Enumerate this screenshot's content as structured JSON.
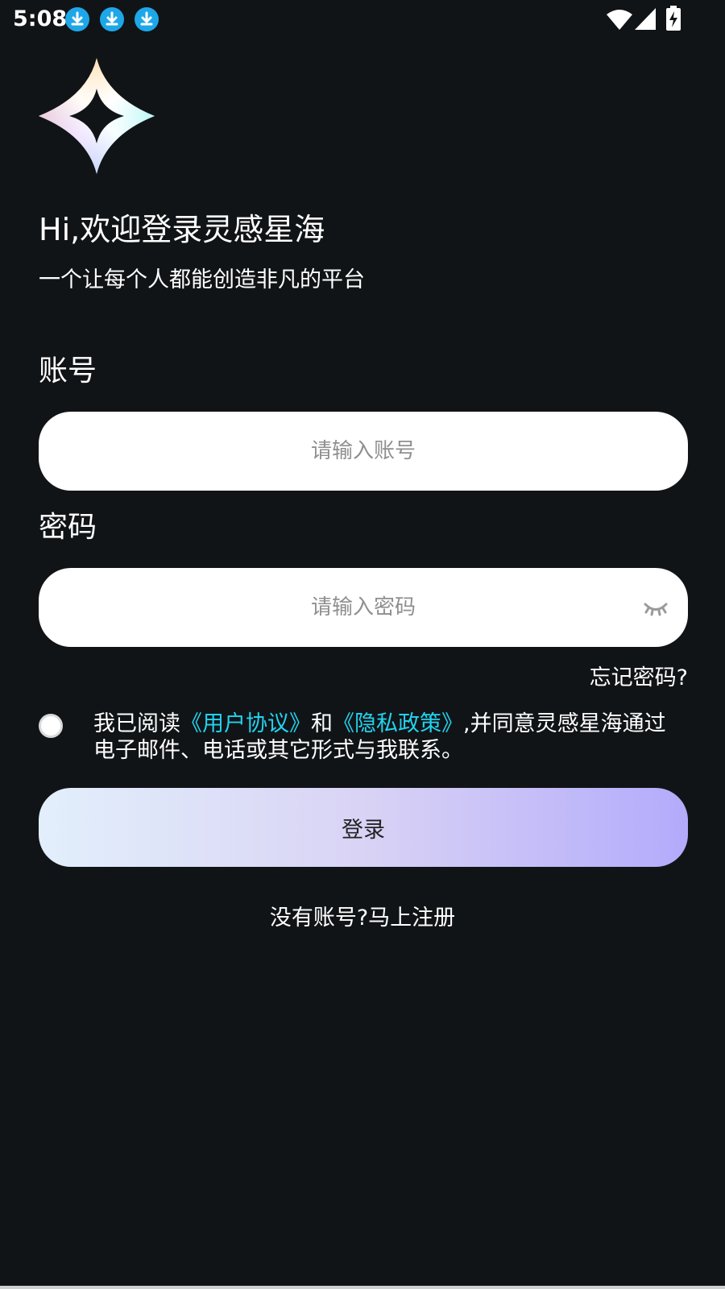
{
  "status_bar": {
    "time": "5:08",
    "notification_icons": [
      "download-icon",
      "download-icon",
      "download-icon"
    ],
    "right_icons": [
      "wifi-icon",
      "signal-icon",
      "battery-charging-icon"
    ]
  },
  "logo": {
    "icon": "star-logo-icon"
  },
  "welcome": {
    "title": "Hi,欢迎登录灵感星海",
    "subtitle": "一个让每个人都能创造非凡的平台"
  },
  "account": {
    "label": "账号",
    "placeholder": "请输入账号",
    "value": ""
  },
  "password": {
    "label": "密码",
    "placeholder": "请输入密码",
    "value": "",
    "toggle_icon": "eye-closed-icon"
  },
  "forgot_password": "忘记密码?",
  "agreement": {
    "checked": false,
    "prefix": "我已阅读",
    "user_agreement": "《用户协议》",
    "middle": "和",
    "privacy_policy": "《隐私政策》",
    "suffix": ",并同意灵感星海通过电子邮件、电话或其它形式与我联系。"
  },
  "login_button": "登录",
  "register_link": "没有账号?马上注册",
  "colors": {
    "background": "#111417",
    "link": "#22d3ee",
    "download_badge": "#1ea7e8",
    "button_gradient_start": "#e2effb",
    "button_gradient_end": "#b3abfb"
  }
}
